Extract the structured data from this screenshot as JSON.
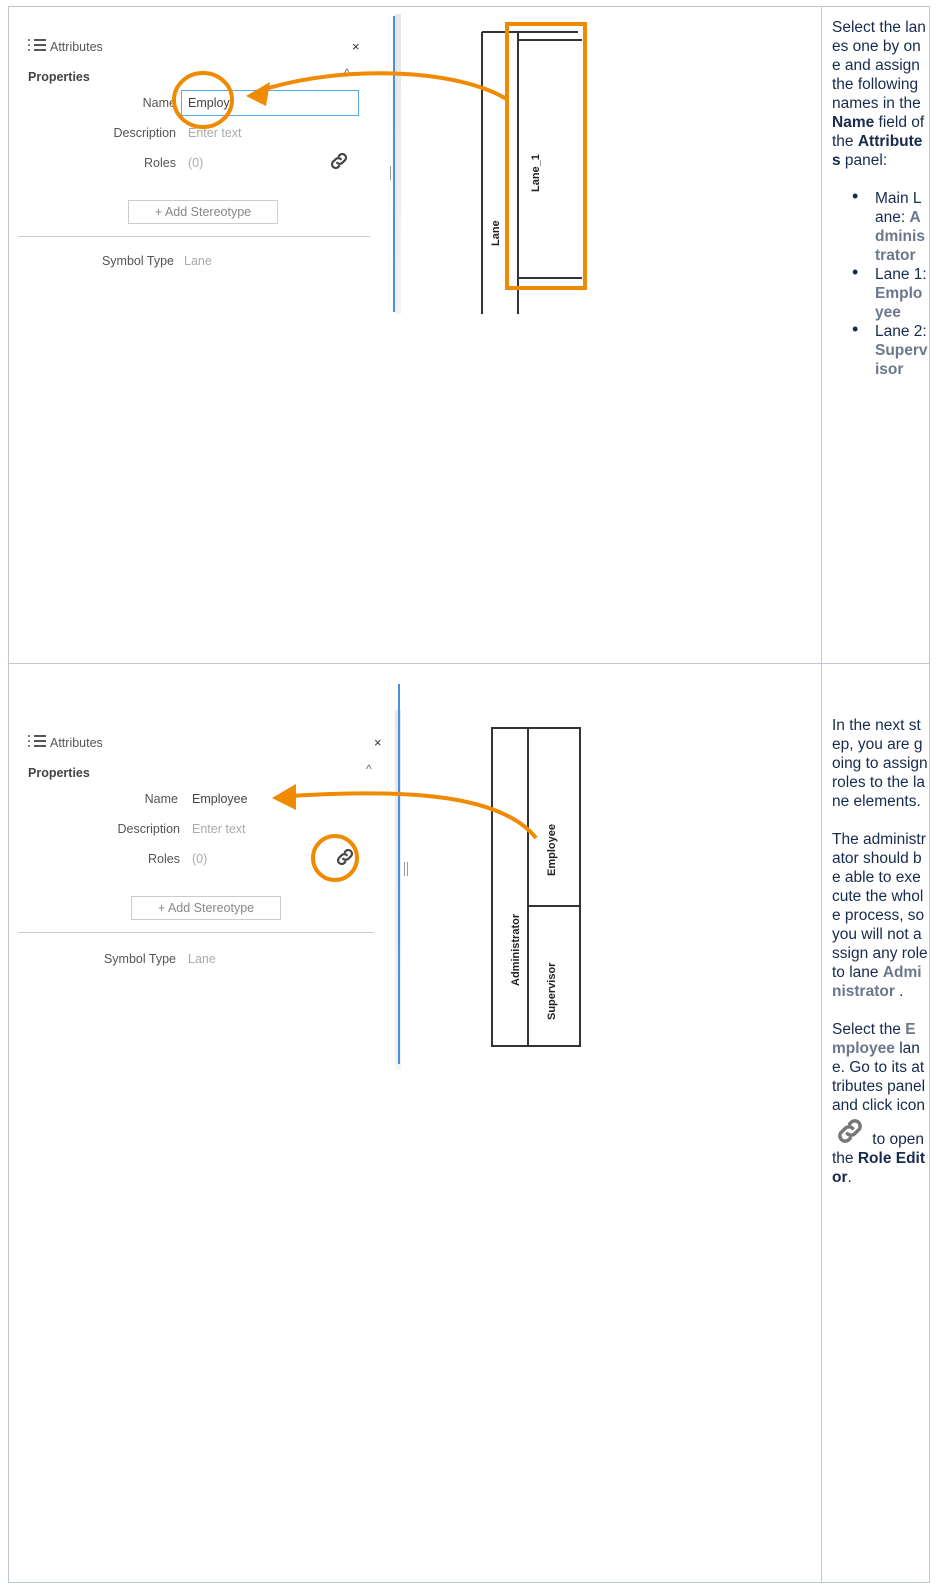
{
  "row1": {
    "panel": {
      "title": "Attributes",
      "close": "×",
      "section": "Properties",
      "caret": "^",
      "name_label": "Name",
      "name_value": "Employ",
      "description_label": "Description",
      "description_placeholder": "Enter text",
      "roles_label": "Roles",
      "roles_value": "(0)",
      "add_stereotype": "+ Add Stereotype",
      "symbol_type_label": "Symbol Type",
      "symbol_type_value": "Lane"
    },
    "diagram": {
      "outer_lane": "Lane",
      "inner_lane": "Lane_1"
    },
    "description": {
      "intro_1": "Select the lanes one by one and assign the following names in the ",
      "intro_name": "Name",
      "intro_2": " field of the ",
      "intro_attributes": "Attributes",
      "intro_3": " panel:",
      "items": [
        {
          "label": "Main Lane: ",
          "value": "Administrator"
        },
        {
          "label": "Lane 1: ",
          "value": "Employee"
        },
        {
          "label": "Lane 2: ",
          "value": "Supervisor"
        }
      ]
    }
  },
  "row2": {
    "panel": {
      "title": "Attributes",
      "close": "×",
      "section": "Properties",
      "caret": "^",
      "name_label": "Name",
      "name_value": "Employee",
      "description_label": "Description",
      "description_placeholder": "Enter text",
      "roles_label": "Roles",
      "roles_value": "(0)",
      "add_stereotype": "+ Add Stereotype",
      "symbol_type_label": "Symbol Type",
      "symbol_type_value": "Lane"
    },
    "diagram": {
      "main_lane": "Administrator",
      "lane_1": "Employee",
      "lane_2": "Supervisor"
    },
    "description": {
      "p1": "In the next step, you are going to assign roles to the lane elements.",
      "p2_a": "The administrator should be able to execute the whole process, so you will not assign any role to lane ",
      "p2_b": "Administrator",
      "p2_c": " .",
      "p3_a": "Select the ",
      "p3_b": "Employee",
      "p3_c": " lane. Go to its attributes panel and click icon ",
      "p3_d": " to open the ",
      "p3_e": "Role Editor",
      "p3_f": "."
    }
  },
  "colors": {
    "highlight": "#f08a00",
    "field_border": "#5aa8e6",
    "divider": "#4a90e2"
  },
  "icons": {
    "list": "list-icon",
    "link": "link-icon",
    "close": "close-icon"
  }
}
